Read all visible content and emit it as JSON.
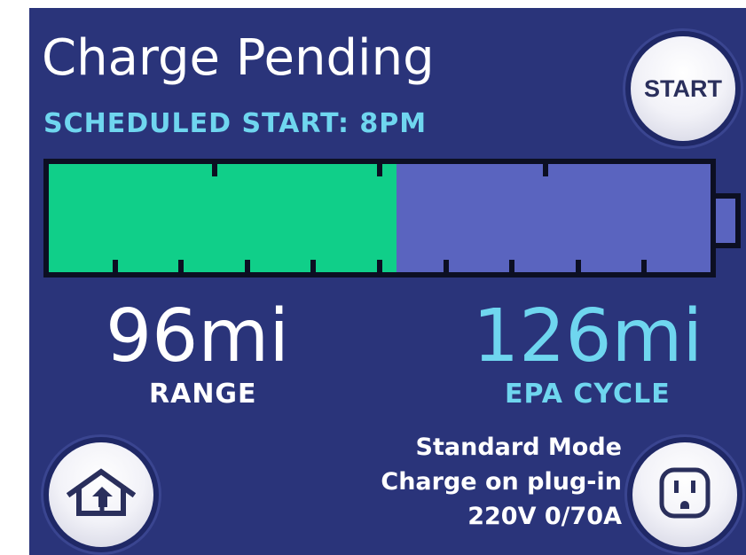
{
  "header": {
    "title": "Charge Pending",
    "subtitle": "SCHEDULED START: 8PM"
  },
  "buttons": {
    "start_label": "START",
    "home_icon": "home-upload-icon",
    "outlet_icon": "power-outlet-icon"
  },
  "battery": {
    "charge_fraction": 0.525
  },
  "stats": {
    "range_value": "96mi",
    "range_label": "RANGE",
    "epa_value": "126mi",
    "epa_label": "EPA CYCLE"
  },
  "info": {
    "mode": "Standard Mode",
    "charge_setting": "Charge on plug-in",
    "power": "220V 0/70A"
  },
  "colors": {
    "background": "#2a347a",
    "charged": "#10cf89",
    "uncharged": "#5a64bf",
    "accent": "#6fd6ef",
    "text": "#ffffff"
  }
}
